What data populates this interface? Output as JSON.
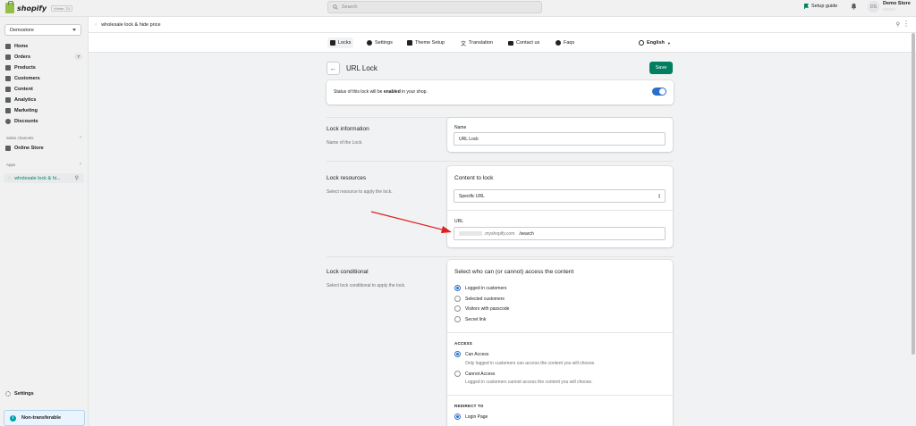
{
  "topbar": {
    "brand": "shopify",
    "edition": "Winter '23",
    "search_placeholder": "Search",
    "setup_guide": "Setup guide",
    "avatar_initials": "DS",
    "store_name": "Demo Store"
  },
  "sidebar": {
    "store_selector": "Demostore",
    "items": [
      {
        "label": "Home"
      },
      {
        "label": "Orders",
        "badge": "7"
      },
      {
        "label": "Products"
      },
      {
        "label": "Customers"
      },
      {
        "label": "Content"
      },
      {
        "label": "Analytics"
      },
      {
        "label": "Marketing"
      },
      {
        "label": "Discounts"
      }
    ],
    "sales_channels_label": "Sales channels",
    "online_store": "Online Store",
    "apps_label": "Apps",
    "app_item": "wholesale lock & hi...",
    "settings": "Settings",
    "non_transferable": "Non-transferable"
  },
  "appbar": {
    "title": "wholesale lock & hide price"
  },
  "appnav": {
    "items": [
      {
        "label": "Locks",
        "icon": "lock-icon"
      },
      {
        "label": "Settings",
        "icon": "gear-icon"
      },
      {
        "label": "Theme Setup",
        "icon": "theme-icon"
      },
      {
        "label": "Translation",
        "icon": "translate-icon"
      },
      {
        "label": "Contact us",
        "icon": "mail-icon"
      },
      {
        "label": "Faqs",
        "icon": "question-icon"
      }
    ],
    "language": "English"
  },
  "page": {
    "title": "URL Lock",
    "save": "Save",
    "status_prefix": "Status of this lock will be ",
    "status_state": "enabled",
    "status_suffix": " in your shop."
  },
  "lock_info": {
    "title": "Lock information",
    "desc": "Name of the Lock.",
    "name_label": "Name",
    "name_value": "URL Lock"
  },
  "lock_resources": {
    "title": "Lock resources",
    "desc": "Select resource to apply the lock.",
    "content_title": "Content to lock",
    "content_value": "Specific URL",
    "url_label": "URL",
    "url_domain": ".myshopify.com",
    "url_path": "/search"
  },
  "lock_conditional": {
    "title": "Lock conditional",
    "desc": "Select lock conditional to apply the lock.",
    "who_title": "Select who can (or cannot) access the content",
    "who_options": [
      "Logged in customers",
      "Selected customers",
      "Visitors with passcode",
      "Secret link"
    ],
    "access_label": "ACCESS",
    "can_access": "Can Access",
    "can_access_help": "Only logged in customers can access the content you will choose.",
    "cannot_access": "Cannot Access",
    "cannot_access_help": "Logged in customers cannot access the content you will choose.",
    "redirect_label": "REDIRECT TO",
    "redirect_option": "Login Page"
  },
  "colors": {
    "primary": "#008060",
    "toggle": "#2c6ecb",
    "annotation_arrow": "#e02020"
  }
}
